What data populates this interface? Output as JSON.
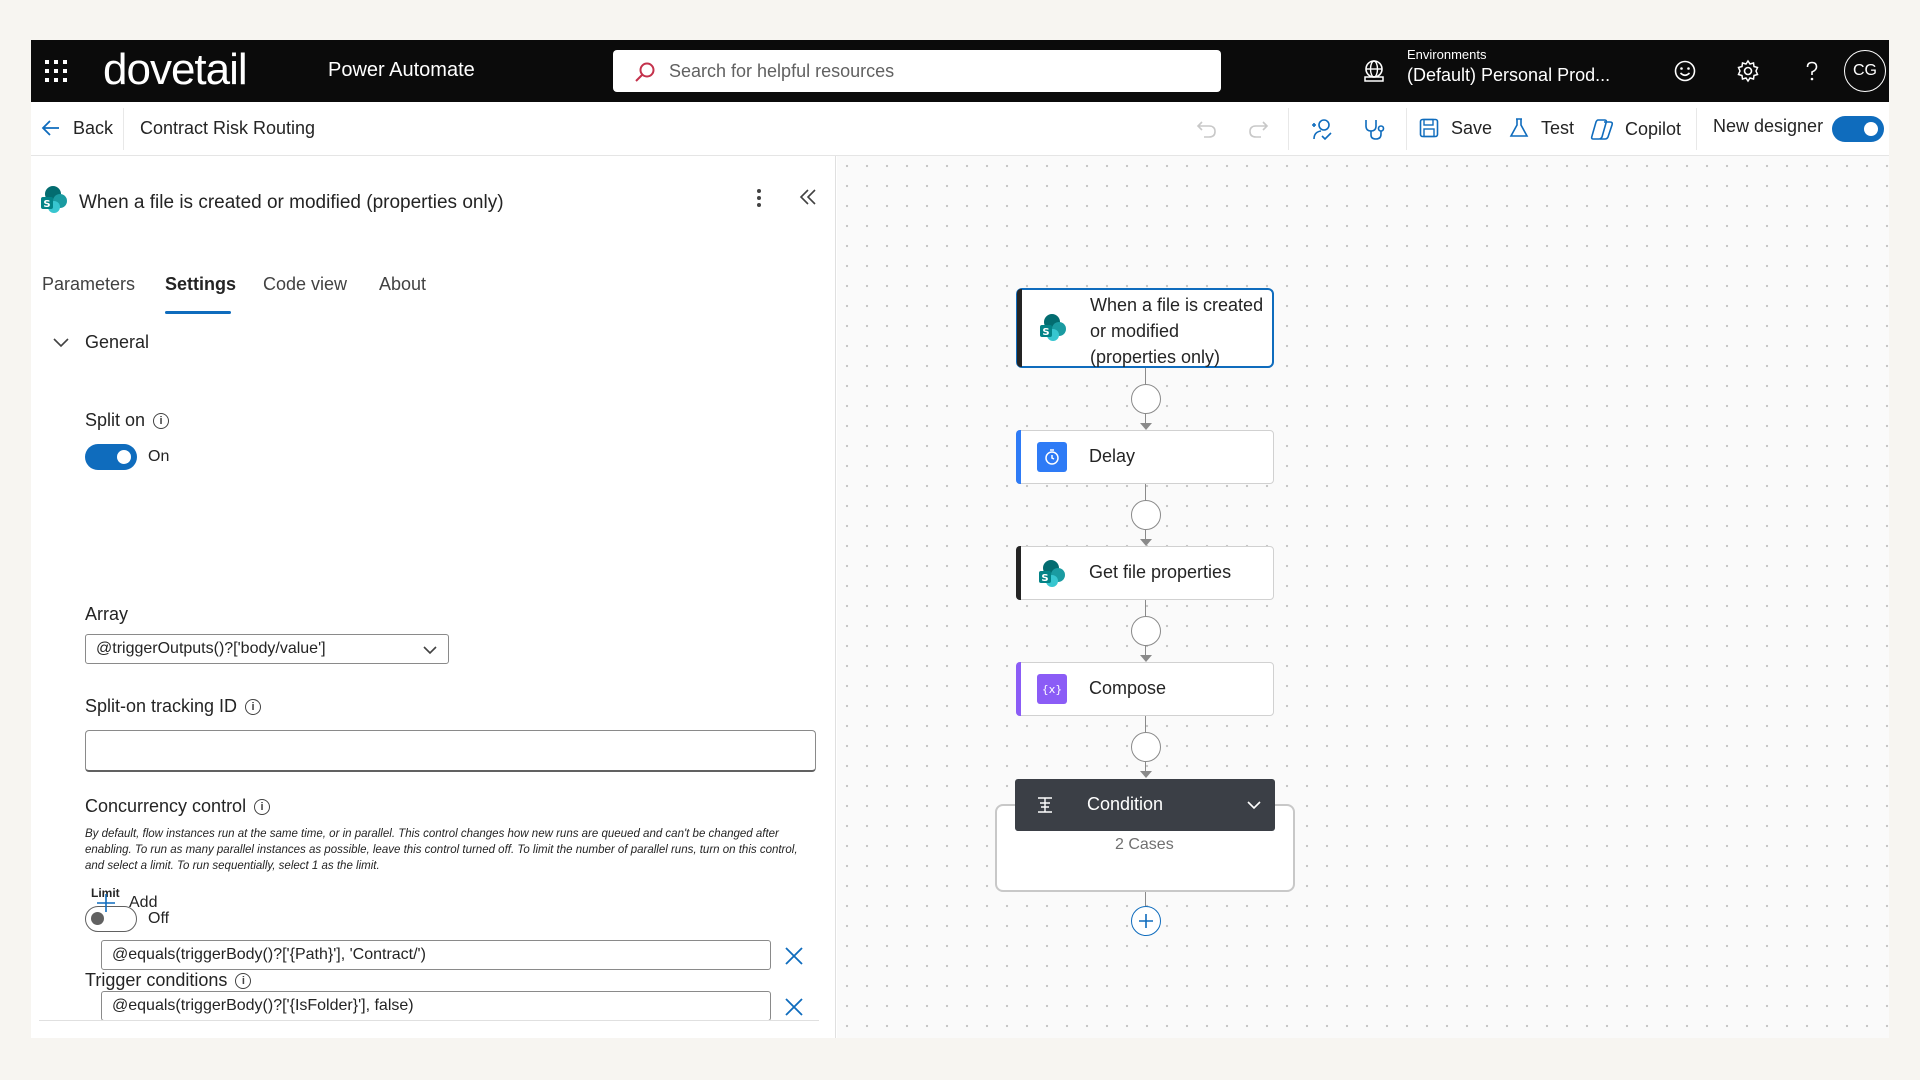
{
  "topbar": {
    "logo": "dovetail",
    "product": "Power Automate",
    "search_placeholder": "Search for helpful resources",
    "env_label": "Environments",
    "env_value": "(Default) Personal Prod...",
    "avatar_initials": "CG"
  },
  "cmdbar": {
    "back": "Back",
    "flow_name": "Contract Risk Routing",
    "save": "Save",
    "test": "Test",
    "copilot": "Copilot",
    "new_designer": "New designer",
    "new_designer_on": true
  },
  "panel": {
    "title": "When a file is created or modified (properties only)",
    "tabs": [
      "Parameters",
      "Settings",
      "Code view",
      "About"
    ],
    "active_tab": "Settings",
    "section": "General",
    "split_on_label": "Split on",
    "split_on_state": "On",
    "array_label": "Array",
    "array_value": "@triggerOutputs()?['body/value']",
    "tracking_label": "Split-on tracking ID",
    "tracking_value": "",
    "concurrency_label": "Concurrency control",
    "concurrency_desc": "By default, flow instances run at the same time, or in parallel. This control changes how new runs are queued and can't be changed after enabling. To run as many parallel instances as possible, leave this control turned off. To limit the number of parallel runs, turn on this control, and select a limit. To run sequentially, select 1 as the limit.",
    "limit_label": "Limit",
    "limit_state": "Off",
    "trigger_conditions_label": "Trigger conditions",
    "add_label": "Add",
    "conditions": [
      "@equals(triggerBody()?['{Path}'], 'Contract/')",
      "@equals(triggerBody()?['{IsFolder}'], false)"
    ]
  },
  "canvas": {
    "nodes": [
      {
        "label_lines": [
          "When a file is created",
          "or modified",
          "(properties only)"
        ],
        "color": "#038387"
      },
      {
        "label": "Delay",
        "color": "#2e7bf6"
      },
      {
        "label": "Get file properties",
        "color": "#036c70"
      },
      {
        "label": "Compose",
        "color": "#8b5cf6"
      },
      {
        "label": "Condition",
        "color": "#3b3f46"
      }
    ],
    "condition_cases": "2 Cases"
  }
}
